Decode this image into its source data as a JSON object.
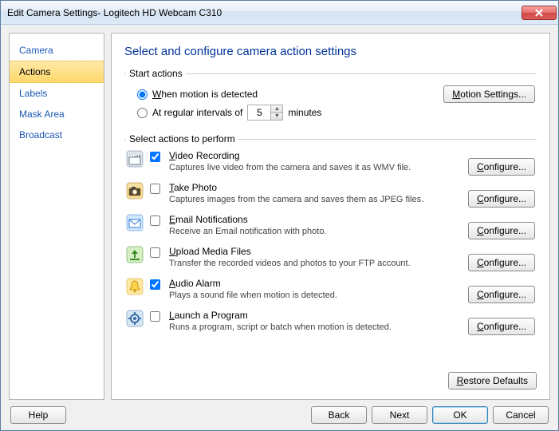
{
  "window": {
    "title": "Edit Camera Settings- Logitech HD Webcam C310"
  },
  "sidebar": {
    "items": [
      {
        "label": "Camera"
      },
      {
        "label": "Actions"
      },
      {
        "label": "Labels"
      },
      {
        "label": "Mask Area"
      },
      {
        "label": "Broadcast"
      }
    ],
    "selectedIndex": 1
  },
  "page": {
    "title": "Select and configure camera action settings",
    "startGroupLabel": "Start actions",
    "performGroupLabel": "Select actions to perform",
    "radio": {
      "whenMotionPrefix": "W",
      "whenMotionRest": "hen motion is detected",
      "atIntervalsPrefix": "At regular intervals of",
      "minutes": "minutes",
      "intervalValue": "5"
    },
    "motionSettingsBtn": "Motion Settings...",
    "configureBtn": "Configure...",
    "restoreBtn": "Restore Defaults",
    "actions": [
      {
        "titlePrefix": "V",
        "titleRest": "ideo Recording",
        "desc": "Captures live video from the camera and saves it as WMV file.",
        "checked": true
      },
      {
        "titlePrefix": "T",
        "titleRest": "ake Photo",
        "desc": "Captures images from the camera and saves them as JPEG files.",
        "checked": false
      },
      {
        "titlePrefix": "E",
        "titleRest": "mail Notifications",
        "desc": "Receive an Email notification with photo.",
        "checked": false
      },
      {
        "titlePrefix": "U",
        "titleRest": "pload Media Files",
        "desc": "Transfer the recorded videos and photos to your FTP account.",
        "checked": false
      },
      {
        "titlePrefix": "A",
        "titleRest": "udio Alarm",
        "desc": "Plays a sound file when motion is detected.",
        "checked": true
      },
      {
        "titlePrefix": "L",
        "titleRest": "aunch a Program",
        "desc": "Runs a program, script or batch when motion is detected.",
        "checked": false
      }
    ]
  },
  "buttons": {
    "help": "Help",
    "back": "Back",
    "next": "Next",
    "ok": "OK",
    "cancel": "Cancel"
  },
  "icons": {
    "0": {
      "bg": "#dde4ea",
      "fg": "#6b7f8f",
      "glyph": "clapper"
    },
    "1": {
      "bg": "#f7e0a0",
      "fg": "#a37a1a",
      "glyph": "camera"
    },
    "2": {
      "bg": "#cfe8ff",
      "fg": "#3a7bd5",
      "glyph": "mail"
    },
    "3": {
      "bg": "#d6f0c4",
      "fg": "#3a8a2a",
      "glyph": "upload"
    },
    "4": {
      "bg": "#ffe9a0",
      "fg": "#c79a1a",
      "glyph": "bell"
    },
    "5": {
      "bg": "#d8e8f5",
      "fg": "#3a6ea5",
      "glyph": "gear"
    }
  }
}
